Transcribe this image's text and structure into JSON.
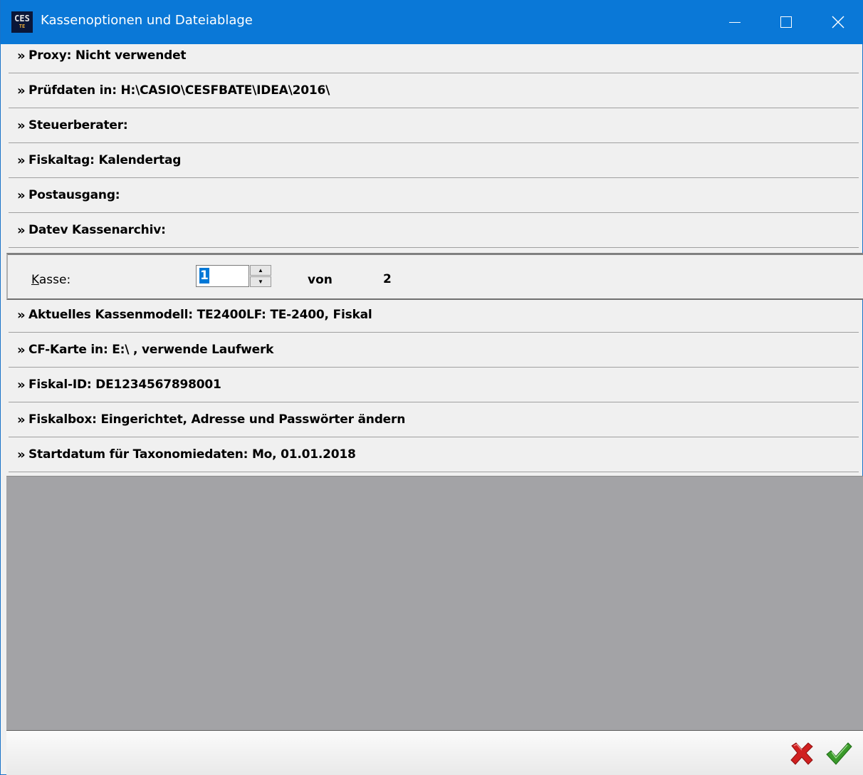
{
  "window": {
    "title": "Kassenoptionen und Dateiablage",
    "icon_text": "CES",
    "icon_subtext": "TE"
  },
  "options_top": [
    {
      "text": "Proxy: Nicht verwendet"
    },
    {
      "text": "Prüfdaten in: H:\\CASIO\\CESFBATE\\IDEA\\2016\\"
    },
    {
      "text": "Steuerberater:"
    },
    {
      "text": "Fiskaltag: Kalendertag"
    },
    {
      "text": "Postausgang:"
    },
    {
      "text": "Datev Kassenarchiv:"
    }
  ],
  "chevron": "»",
  "kasse": {
    "label": "Kasse:",
    "value": "1",
    "of_label": "von",
    "total": "2"
  },
  "options_bottom": [
    {
      "text": "Aktuelles Kassenmodell: TE2400LF: TE-2400, Fiskal"
    },
    {
      "text": "CF-Karte in: E:\\ , verwende Laufwerk"
    },
    {
      "text": "Fiskal-ID: DE1234567898001"
    },
    {
      "text": "Fiskalbox: Eingerichtet, Adresse und Passwörter ändern"
    },
    {
      "text": "Startdatum für Taxonomiedaten: Mo, 01.01.2018"
    }
  ],
  "icons": {
    "cancel": "cancel-x-icon",
    "ok": "checkmark-icon"
  },
  "colors": {
    "titlebar": "#0a78d7",
    "cancel": "#d02020",
    "ok": "#3a9a2a"
  }
}
